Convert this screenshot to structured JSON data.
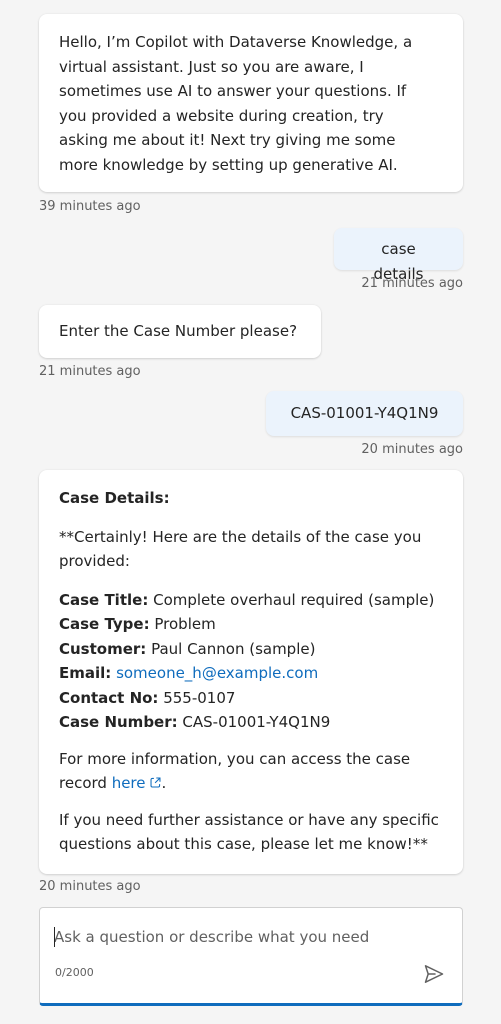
{
  "messages": {
    "welcome": {
      "text": "Hello, I'm Copilot with Dataverse Knowledge, a virtual assistant. Just so you are aware, I sometimes use AI to answer your questions. If you provided a website during creation, try asking me about it! Next try giving me some more knowledge by setting up generative AI.",
      "lines": [
        "Hello, I’m Copilot with Dataverse Knowledge, a",
        "virtual assistant. Just so you are aware, I",
        "sometimes use AI to answer your questions. If",
        "you provided a website during creation, try",
        "asking me about it! Next try giving me some",
        "more knowledge by setting up generative AI."
      ],
      "timestamp": "39 minutes ago"
    },
    "user1": {
      "text": "case details",
      "timestamp": "21 minutes ago"
    },
    "bot_prompt": {
      "text": "Enter the Case Number please?",
      "timestamp": "21 minutes ago"
    },
    "user2": {
      "text": "CAS-01001-Y4Q1N9",
      "timestamp": "20 minutes ago"
    },
    "case_details": {
      "heading": "Case Details:",
      "intro_line1": "**Certainly! Here are the details of the case you",
      "intro_line2": "provided:",
      "fields": [
        {
          "label": "Case Title:",
          "value": "Complete overhaul required (sample)"
        },
        {
          "label": "Case Type:",
          "value": "Problem"
        },
        {
          "label": "Customer:",
          "value": "Paul Cannon (sample)"
        },
        {
          "label": "Email:",
          "value": "someone_h@example.com"
        },
        {
          "label": "Contact No:",
          "value": "555-0107"
        },
        {
          "label": "Case Number:",
          "value": "CAS-01001-Y4Q1N9"
        }
      ],
      "more_info_line1": "For more information, you can access the case",
      "more_info_prefix": "record ",
      "more_info_link": "here",
      "more_info_suffix": ".",
      "closing_line1": "If you need further assistance or have any specific",
      "closing_line2": "questions about this case, please let me know!**",
      "timestamp": "20 minutes ago"
    }
  },
  "composer": {
    "placeholder": "Ask a question or describe what you need",
    "value": "",
    "counter": "0/2000",
    "send_icon": "send-icon",
    "accent": "#0f6cbd"
  },
  "colors": {
    "background": "#f5f5f5",
    "bot_bubble": "#ffffff",
    "user_bubble": "#ebf3fc",
    "link": "#0f6cbd"
  }
}
